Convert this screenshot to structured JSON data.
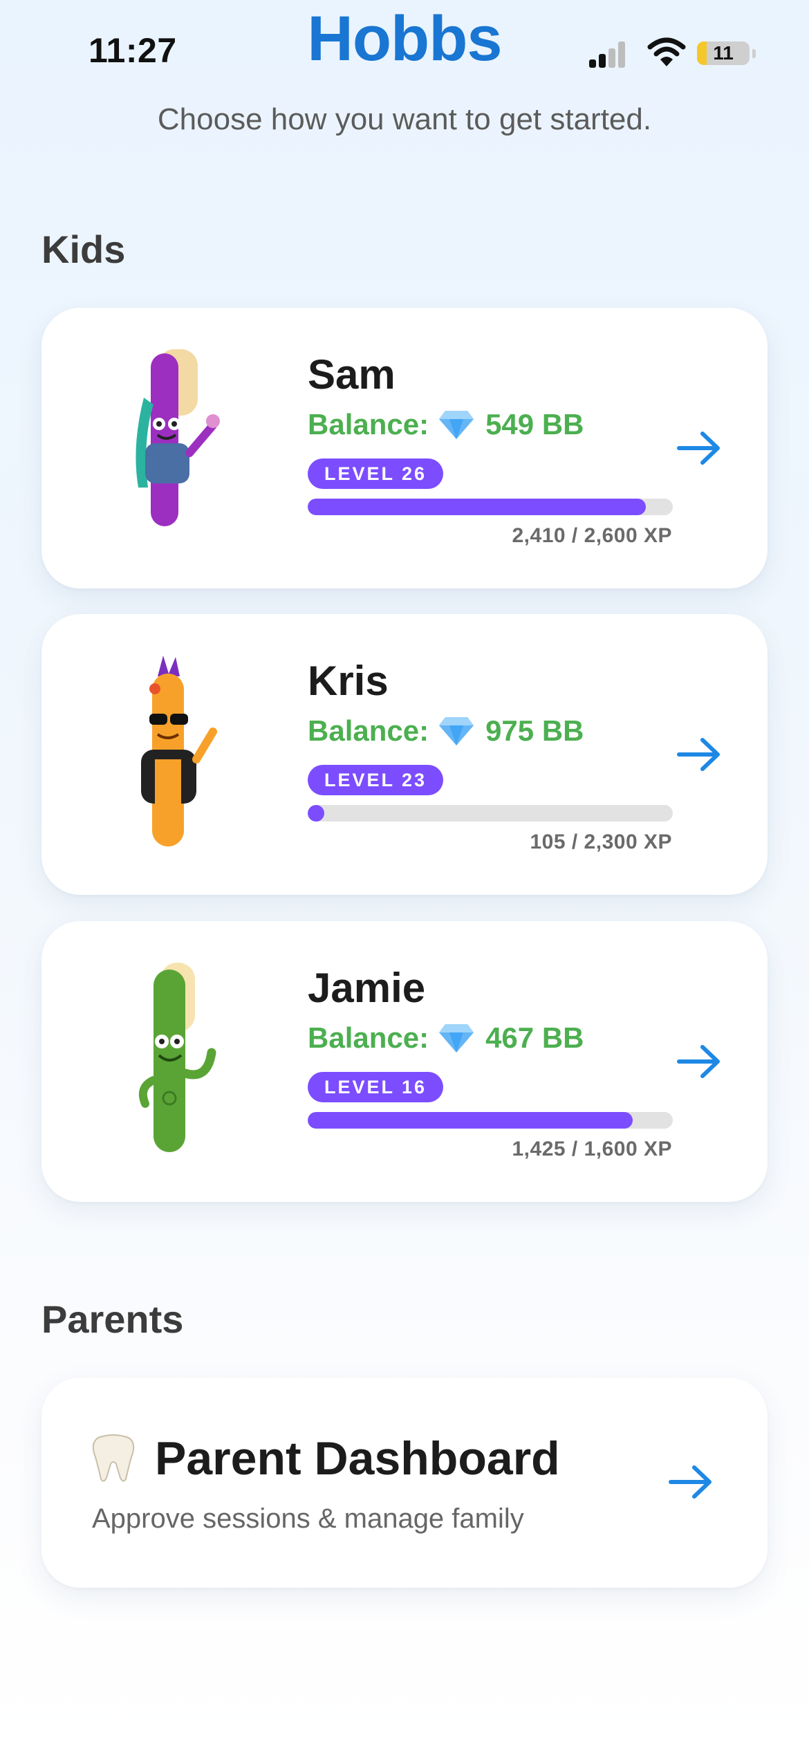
{
  "status_bar": {
    "time": "11:27",
    "battery": "11"
  },
  "header": {
    "title": "Hobbs",
    "subtitle": "Choose how you want to get started."
  },
  "kids_section": {
    "title": "Kids",
    "balance_label": "Balance:",
    "kids": [
      {
        "name": "Sam",
        "balance": "549 BB",
        "level": "LEVEL 26",
        "xp_text": "2,410 / 2,600 XP",
        "xp_progress": 0.927,
        "avatar": "purple-toothbrush-character"
      },
      {
        "name": "Kris",
        "balance": "975 BB",
        "level": "LEVEL 23",
        "xp_text": "105 / 2,300 XP",
        "xp_progress": 0.046,
        "avatar": "orange-toothbrush-character"
      },
      {
        "name": "Jamie",
        "balance": "467 BB",
        "level": "LEVEL 16",
        "xp_text": "1,425 / 1,600 XP",
        "xp_progress": 0.891,
        "avatar": "green-toothbrush-character"
      }
    ]
  },
  "parents_section": {
    "title": "Parents",
    "dashboard": {
      "title": "Parent Dashboard",
      "subtitle": "Approve sessions & manage family",
      "icon": "tooth-icon"
    }
  },
  "colors": {
    "accent": "#1976d2",
    "balance": "#4caf50",
    "level": "#7c4dff",
    "track": "#e2e2e2"
  },
  "icons": {
    "gem": "gem-icon",
    "arrow": "arrow-right-icon"
  }
}
